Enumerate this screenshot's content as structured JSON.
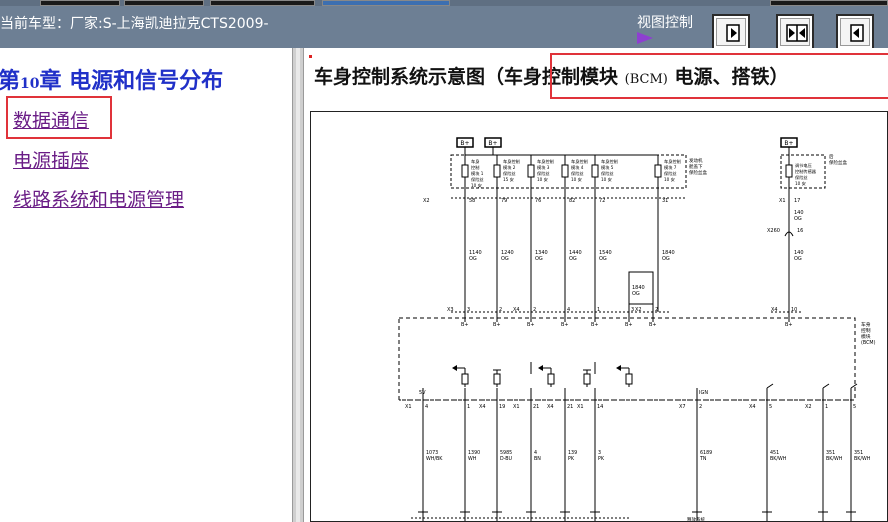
{
  "header": {
    "model_label": "当前车型：厂家:S-上海凯迪拉克CTS2009-",
    "view_control_label": "视图控制",
    "buttons": [
      {
        "icon": "arrow-right-icon"
      },
      {
        "icon": "double-arrow-icon"
      },
      {
        "icon": "arrow-left-icon"
      }
    ]
  },
  "nav": {
    "chapter_prefix": "第",
    "chapter_num": "10",
    "chapter_suffix": "章 电源和信号分布",
    "links": [
      "数据通信",
      "电源插座",
      "线路系统和电源管理"
    ]
  },
  "content": {
    "title_part1": "车身控制系统示意图（车身控制模块 ",
    "title_bcm": "(BCM)",
    "title_part2": " 电源、搭铁）"
  },
  "diagram": {
    "bplus": "B+",
    "fuse_labels": [
      [
        "车身",
        "控制",
        "模块 1",
        "保险丝",
        "10 安"
      ],
      [
        "车身控制",
        "模块 2",
        "保险丝",
        "15 安"
      ],
      [
        "车身控制",
        "模块 3",
        "保险丝",
        "10 安"
      ],
      [
        "车身控制",
        "模块 4",
        "保险丝",
        "10 安"
      ],
      [
        "车身控制",
        "模块 5",
        "保险丝",
        "10 安"
      ],
      [
        "车身控制",
        "模块 7",
        "保险丝",
        "10 安"
      ]
    ],
    "fuse_box_label": [
      "发动机",
      "舱盖下",
      "保险丝盒"
    ],
    "rear_fuse": [
      "调节电压",
      "控制传感器",
      "保险丝",
      "10 安"
    ],
    "rear_fuse_box": [
      "后",
      "保险丝盒"
    ],
    "top_connector": "X2",
    "top_pins": [
      "58",
      "79",
      "76",
      "82",
      "72",
      "31"
    ],
    "rear_conn": "X1",
    "rear_pin": "17",
    "wires_top": [
      [
        "1140",
        "OG"
      ],
      [
        "1240",
        "OG"
      ],
      [
        "1340",
        "OG"
      ],
      [
        "1440",
        "OG"
      ],
      [
        "1540",
        "OG"
      ],
      [
        "1840",
        "OG"
      ]
    ],
    "rear_wire1": [
      "140",
      "OG"
    ],
    "x260": "X260",
    "x260_pin": "16",
    "rear_wire2": [
      "140",
      "OG"
    ],
    "mid_wire": [
      "1840",
      "OG"
    ],
    "bcm_pins_top": [
      {
        "conn": "X3",
        "pin": "3"
      },
      {
        "conn": "",
        "pin": "2"
      },
      {
        "conn": "X4",
        "pin": "2"
      },
      {
        "conn": "",
        "pin": "4"
      },
      {
        "conn": "",
        "pin": "1"
      },
      {
        "conn": "",
        "pin": "3"
      },
      {
        "conn": "X2",
        "pin": "2"
      },
      {
        "conn": "X4",
        "pin": "10"
      }
    ],
    "bplus_small": "B+",
    "bcm_label": [
      "车身",
      "控制",
      "模块",
      "(BCM)"
    ],
    "five_v": "5V",
    "ign": "IGN",
    "bottom_pins": [
      {
        "conn": "X1",
        "pin": "4"
      },
      {
        "conn": "",
        "pin": "1"
      },
      {
        "conn": "X4",
        "pin": "19"
      },
      {
        "conn": "X1",
        "pin": "21"
      },
      {
        "conn": "X4",
        "pin": "21"
      },
      {
        "conn": "X1",
        "pin": "14"
      },
      {
        "conn": "X7",
        "pin": "2"
      },
      {
        "conn": "X4",
        "pin": "5"
      },
      {
        "conn": "X2",
        "pin": "1"
      },
      {
        "conn": "",
        "pin": "5"
      }
    ],
    "bottom_wires": [
      [
        "1073",
        "WH/BK"
      ],
      [
        "1390",
        "WH"
      ],
      [
        "5985",
        "D-BU"
      ],
      [
        "4",
        "BN"
      ],
      [
        "139",
        "PK"
      ],
      [
        "3",
        "PK"
      ],
      [
        "6189",
        "TN"
      ],
      [
        "451",
        "BK/WH"
      ],
      [
        "351",
        "BK/WH"
      ],
      [
        "351",
        "BK/WH"
      ]
    ],
    "bottom_note": "释放系统"
  }
}
